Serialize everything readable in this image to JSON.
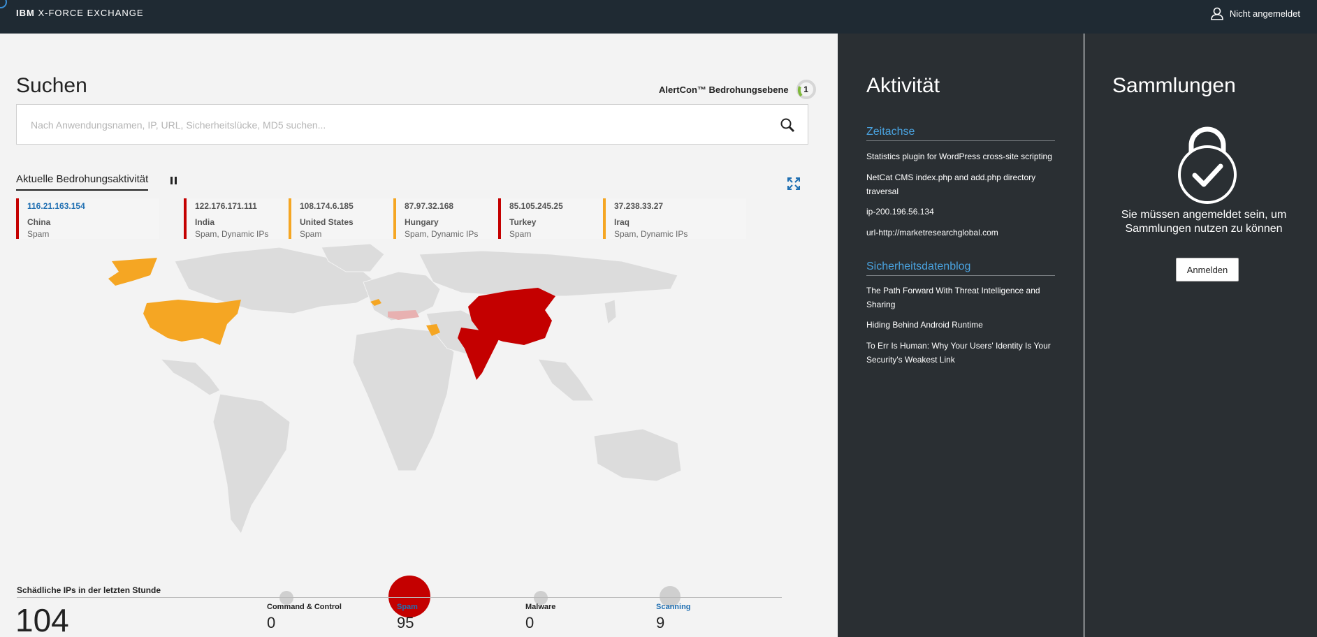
{
  "header": {
    "brand_ibm": "IBM",
    "brand_name": "X-FORCE EXCHANGE",
    "user_status": "Nicht angemeldet"
  },
  "search": {
    "title": "Suchen",
    "placeholder": "Nach Anwendungsnamen, IP, URL, Sicherheitslücke, MD5 suchen...",
    "alertcon_label": "AlertCon™ Bedrohungsebene",
    "alertcon_level": "1"
  },
  "threat_activity": {
    "tab_label": "Aktuelle Bedrohungsaktivität",
    "cards": [
      {
        "ip": "116.21.163.154",
        "country": "China",
        "tags": "Spam",
        "color": "#c40000",
        "highlight": true
      },
      {
        "ip": "122.176.171.111",
        "country": "India",
        "tags": "Spam, Dynamic IPs",
        "color": "#c40000",
        "highlight": false
      },
      {
        "ip": "108.174.6.185",
        "country": "United States",
        "tags": "Spam",
        "color": "#f5a623",
        "highlight": false
      },
      {
        "ip": "87.97.32.168",
        "country": "Hungary",
        "tags": "Spam, Dynamic IPs",
        "color": "#f5a623",
        "highlight": false
      },
      {
        "ip": "85.105.245.25",
        "country": "Turkey",
        "tags": "Spam",
        "color": "#c40000",
        "highlight": false
      },
      {
        "ip": "37.238.33.27",
        "country": "Iraq",
        "tags": "Spam, Dynamic IPs",
        "color": "#f5a623",
        "highlight": false
      }
    ]
  },
  "stats": {
    "label": "Schädliche IPs in der letzten Stunde",
    "total": "104",
    "items": [
      {
        "label": "Command & Control",
        "value": "0",
        "highlight": false
      },
      {
        "label": "Spam",
        "value": "95",
        "highlight": true
      },
      {
        "label": "Malware",
        "value": "0",
        "highlight": false
      },
      {
        "label": "Scanning",
        "value": "9",
        "highlight": true
      }
    ]
  },
  "activity": {
    "title": "Aktivität",
    "timeline_title": "Zeitachse",
    "timeline": [
      "Statistics plugin for WordPress cross-site scripting",
      "NetCat CMS index.php and add.php directory traversal",
      "ip-200.196.56.134",
      "url-http://marketresearchglobal.com"
    ],
    "blog_title": "Sicherheitsdatenblog",
    "blog": [
      "The Path Forward With Threat Intelligence and Sharing",
      "Hiding Behind Android Runtime",
      "To Err Is Human: Why Your Users' Identity Is Your Security's Weakest Link"
    ]
  },
  "collections": {
    "title": "Sammlungen",
    "message": "Sie müssen angemeldet sein, um Sammlungen nutzen zu können",
    "login_button": "Anmelden"
  },
  "colors": {
    "header_bg": "#1f2a33",
    "panel_bg": "#2a2f33",
    "accent_blue": "#4aa3e0",
    "threat_red": "#c40000",
    "threat_orange": "#f5a623"
  }
}
